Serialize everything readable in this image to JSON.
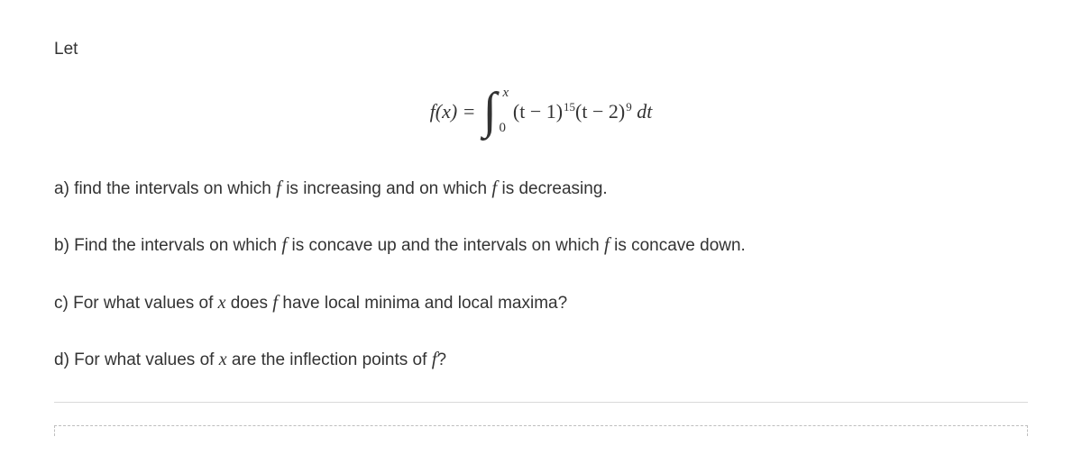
{
  "intro": "Let",
  "formula": {
    "lhs": "f(x) =",
    "int_upper": "x",
    "int_lower": "0",
    "integrand_p1": "(t − 1)",
    "exp1": "15",
    "integrand_p2": "(t − 2)",
    "exp2": "9",
    "dt": " dt"
  },
  "questions": {
    "a": {
      "label": "a) find the intervals on which ",
      "f1": "f",
      "mid1": " is increasing and on which ",
      "f2": "f",
      "end": " is decreasing."
    },
    "b": {
      "label": "b) Find the intervals on which ",
      "f1": "f",
      "mid1": " is concave up and the intervals on which ",
      "f2": "f",
      "end": " is concave down."
    },
    "c": {
      "label": "c) For what values of ",
      "x": "x",
      "mid1": " does ",
      "f1": "f",
      "end": " have local minima and local maxima?"
    },
    "d": {
      "label": "d) For what values of ",
      "x": "x",
      "mid1": " are the inflection points of ",
      "f1": "f",
      "end": "?"
    }
  }
}
